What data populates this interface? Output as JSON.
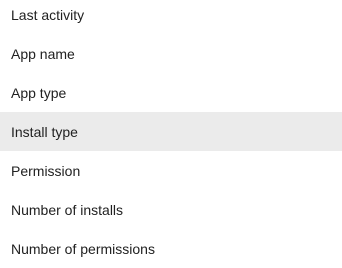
{
  "menu": {
    "items": [
      {
        "label": "Last activity"
      },
      {
        "label": "App name"
      },
      {
        "label": "App type"
      },
      {
        "label": "Install type",
        "highlighted": true
      },
      {
        "label": "Permission"
      },
      {
        "label": "Number of installs"
      },
      {
        "label": "Number of permissions"
      }
    ]
  },
  "colors": {
    "text": "#212121",
    "highlight_background": "#ebebeb",
    "background": "#ffffff"
  }
}
